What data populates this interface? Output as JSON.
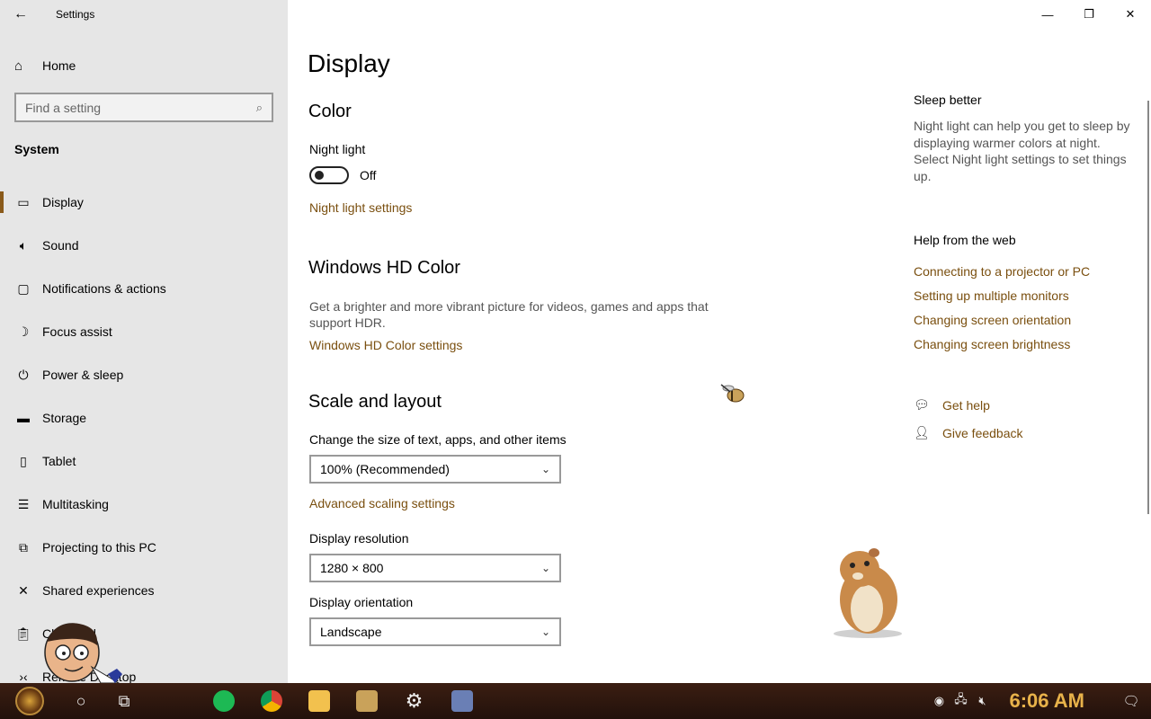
{
  "window": {
    "title": "Settings"
  },
  "sidebar": {
    "home_label": "Home",
    "search_placeholder": "Find a setting",
    "section": "System",
    "items": [
      {
        "label": "Display",
        "icon": "monitor-icon",
        "active": true
      },
      {
        "label": "Sound",
        "icon": "speaker-icon"
      },
      {
        "label": "Notifications & actions",
        "icon": "notification-icon"
      },
      {
        "label": "Focus assist",
        "icon": "moon-icon"
      },
      {
        "label": "Power & sleep",
        "icon": "power-icon"
      },
      {
        "label": "Storage",
        "icon": "storage-icon"
      },
      {
        "label": "Tablet",
        "icon": "tablet-icon"
      },
      {
        "label": "Multitasking",
        "icon": "multitasking-icon"
      },
      {
        "label": "Projecting to this PC",
        "icon": "projector-icon"
      },
      {
        "label": "Shared experiences",
        "icon": "shared-icon"
      },
      {
        "label": "Clipboard",
        "icon": "clipboard-icon"
      },
      {
        "label": "Remote Desktop",
        "icon": "remote-icon"
      }
    ]
  },
  "main": {
    "title": "Display",
    "color": {
      "heading": "Color",
      "night_light_label": "Night light",
      "night_light_state": "Off",
      "night_light_link": "Night light settings"
    },
    "hdr": {
      "heading": "Windows HD Color",
      "description": "Get a brighter and more vibrant picture for videos, games and apps that support HDR.",
      "link": "Windows HD Color settings"
    },
    "scale": {
      "heading": "Scale and layout",
      "size_label": "Change the size of text, apps, and other items",
      "size_value": "100% (Recommended)",
      "advanced_link": "Advanced scaling settings",
      "resolution_label": "Display resolution",
      "resolution_value": "1280 × 800",
      "orientation_label": "Display orientation",
      "orientation_value": "Landscape"
    }
  },
  "right": {
    "sleep_heading": "Sleep better",
    "sleep_desc": "Night light can help you get to sleep by displaying warmer colors at night. Select Night light settings to set things up.",
    "web_heading": "Help from the web",
    "links": [
      "Connecting to a projector or PC",
      "Setting up multiple monitors",
      "Changing screen orientation",
      "Changing screen brightness"
    ],
    "get_help": "Get help",
    "give_feedback": "Give feedback"
  },
  "taskbar": {
    "clock": "6:06 AM",
    "apps": [
      {
        "name": "spotify-app",
        "color": "#1db954"
      },
      {
        "name": "chrome-app",
        "color": "#db4437"
      },
      {
        "name": "file-explorer-app",
        "color": "#f2c14e"
      },
      {
        "name": "game-box-app",
        "color": "#c9a25a"
      },
      {
        "name": "settings-app",
        "color": "#dddddd"
      },
      {
        "name": "keyboard-app",
        "color": "#6a7fb5"
      }
    ]
  },
  "colors": {
    "accent": "#7a4f0f",
    "sidebar_bg": "#e6e6e6"
  }
}
